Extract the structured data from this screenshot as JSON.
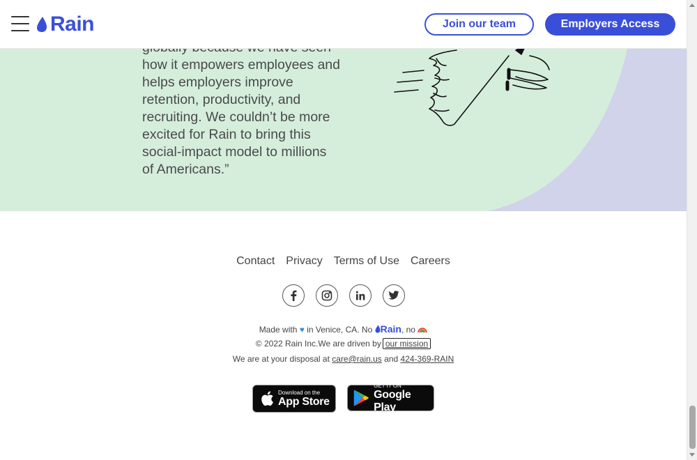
{
  "header": {
    "logo_text": "Rain",
    "join_button": "Join our team",
    "employers_button": "Employers Access"
  },
  "testimonial": {
    "lines": [
      "globally because we have seen",
      "how it empowers employees and",
      "helps employers improve",
      "retention, productivity, and",
      "recruiting. We couldn’t be more",
      "excited for Rain to bring this",
      "social-impact model to millions",
      "of Americans.”"
    ]
  },
  "footer": {
    "links": [
      "Contact",
      "Privacy",
      "Terms of Use",
      "Careers"
    ],
    "socials": [
      "facebook-icon",
      "instagram-icon",
      "linkedin-icon",
      "twitter-icon"
    ],
    "made_with_prefix": "Made with",
    "made_with_middle": "in Venice, CA. No",
    "made_with_logo": "Rain",
    "made_with_suffix": ", no",
    "copyright": "© 2022 Rain Inc.We are driven by",
    "mission_link": "our mission",
    "disposal_prefix": "We are at your disposal at",
    "email": "care@rain.us",
    "and_text": "and",
    "phone": "424-369-RAIN"
  },
  "badges": {
    "apple_small": "Download on the",
    "apple_big": "App Store",
    "google_small": "GET IT ON",
    "google_big": "Google Play"
  },
  "colors": {
    "brand": "#3a4fd8",
    "hero_green": "#d5eedc",
    "hero_lavender": "#d0d3ea"
  }
}
